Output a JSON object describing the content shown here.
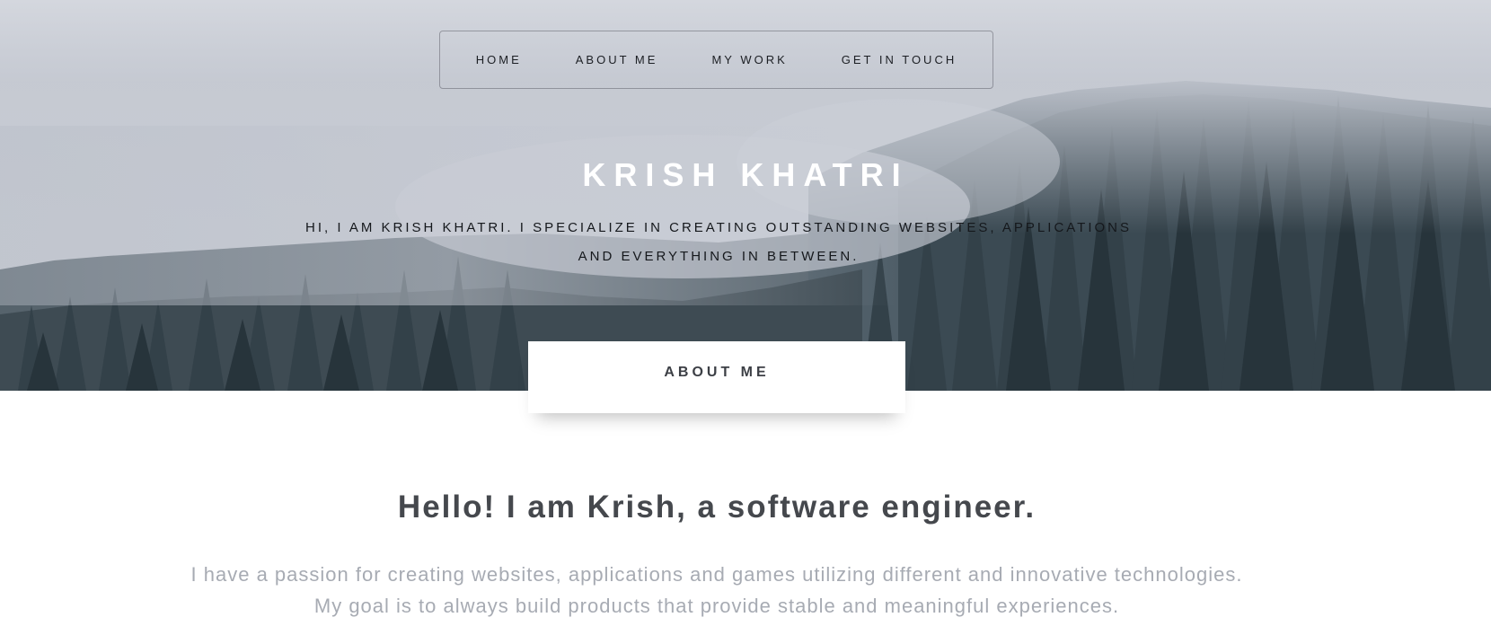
{
  "nav": {
    "items": [
      {
        "label": "HOME"
      },
      {
        "label": "ABOUT ME"
      },
      {
        "label": "MY WORK"
      },
      {
        "label": "GET IN TOUCH"
      }
    ]
  },
  "hero": {
    "title": "KRISH KHATRI",
    "subtitle": "HI, I AM KRISH KHATRI. I SPECIALIZE IN CREATING OUTSTANDING WEBSITES, APPLICATIONS AND EVERYTHING IN BETWEEN."
  },
  "about": {
    "tab_label": "ABOUT ME",
    "heading": "Hello! I am Krish, a software engineer.",
    "body": "I have a passion for creating websites, applications and games utilizing different and innovative technologies. My goal is to always build products that provide stable and meaningful experiences."
  },
  "colors": {
    "hero_sky": "#d3d6dd",
    "forest_dark": "#2f3d45",
    "title_white": "#ffffff",
    "heading_gray": "#45484d",
    "body_gray": "#a7abb3"
  }
}
